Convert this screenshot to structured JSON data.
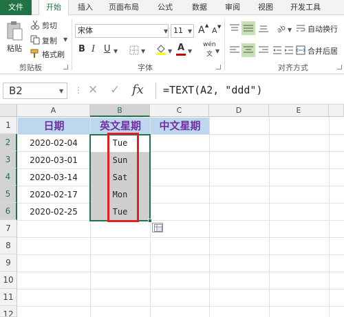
{
  "tabs": [
    "文件",
    "开始",
    "插入",
    "页面布局",
    "公式",
    "数据",
    "审阅",
    "视图",
    "开发工具"
  ],
  "clipboard": {
    "paste": "粘贴",
    "cut": "剪切",
    "copy": "复制",
    "format_painter": "格式刷",
    "group_label": "剪贴板"
  },
  "font": {
    "name": "宋体",
    "size": "11",
    "bold": "B",
    "italic": "I",
    "underline": "U",
    "grow": "A",
    "shrink": "A",
    "font_color_letter": "A",
    "phonetic": "wén",
    "group_label": "字体"
  },
  "alignment": {
    "wrap": "自动换行",
    "merge": "合并后居",
    "group_label": "对齐方式"
  },
  "formula_bar": {
    "cell_ref": "B2",
    "cancel": "✕",
    "enter": "✓",
    "fx": "fx",
    "formula": "=TEXT(A2, \"ddd\")"
  },
  "columns": [
    "A",
    "B",
    "C",
    "D",
    "E"
  ],
  "rows": [
    "1",
    "2",
    "3",
    "4",
    "5",
    "6",
    "7",
    "8",
    "9",
    "10",
    "11",
    "12"
  ],
  "header_row": [
    "日期",
    "英文星期",
    "中文星期"
  ],
  "data_rows": [
    {
      "date": "2020-02-04",
      "weekday": "Tue"
    },
    {
      "date": "2020-03-01",
      "weekday": "Sun"
    },
    {
      "date": "2020-03-14",
      "weekday": "Sat"
    },
    {
      "date": "2020-02-17",
      "weekday": "Mon"
    },
    {
      "date": "2020-02-25",
      "weekday": "Tue"
    }
  ],
  "colors": {
    "accent": "#217346",
    "header_fill": "#bdd7ee",
    "header_text": "#7030a0",
    "highlight": "#e02020"
  }
}
